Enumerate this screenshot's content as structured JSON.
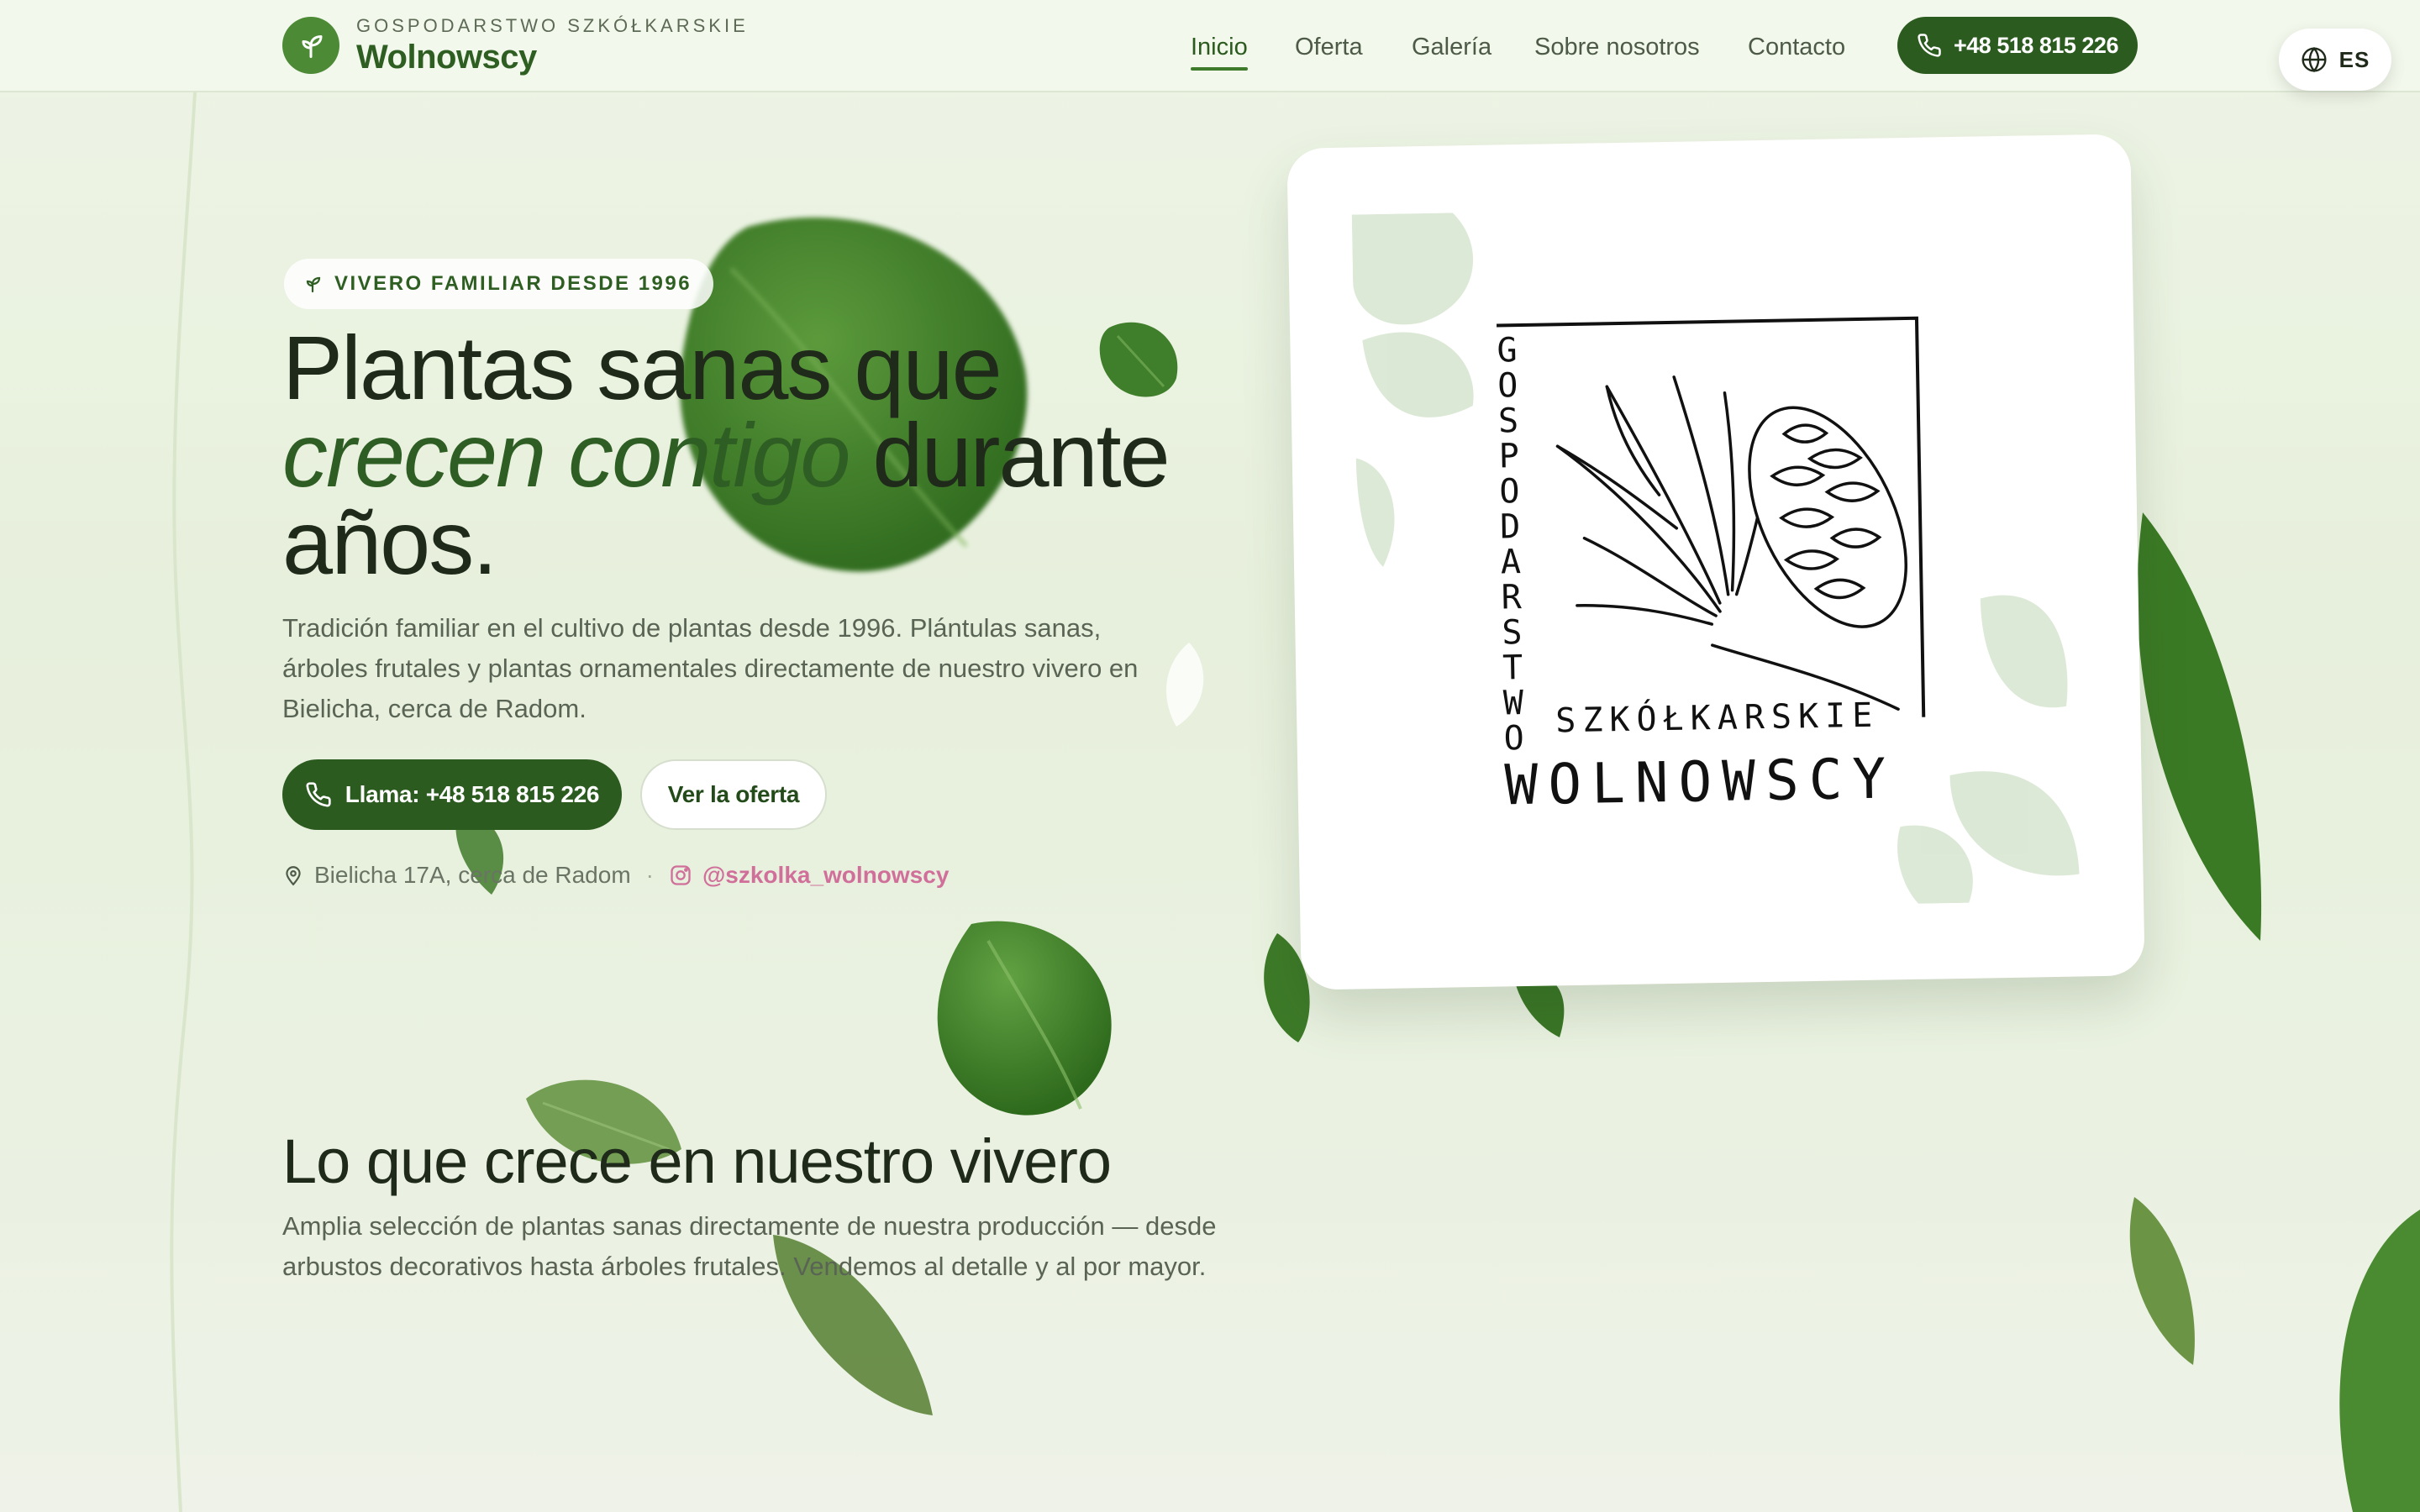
{
  "brand": {
    "eyebrow": "GOSPODARSTWO SZKÓŁKARSKIE",
    "name": "Wolnowscy"
  },
  "nav": {
    "items": [
      {
        "label": "Inicio",
        "active": true
      },
      {
        "label": "Oferta",
        "active": false
      },
      {
        "label": "Galería",
        "active": false
      },
      {
        "label": "Sobre nosotros",
        "active": false
      },
      {
        "label": "Contacto",
        "active": false
      }
    ],
    "call_label": "+48 518 815 226",
    "lang_label": "ES"
  },
  "hero": {
    "badge": "VIVERO FAMILIAR DESDE 1996",
    "title_line1": "Plantas sanas que",
    "title_accent": "crecen contigo",
    "title_rest": " durante",
    "title_line3": "años.",
    "description": "Tradición familiar en el cultivo de plantas desde 1996. Plántulas sanas, árboles frutales y plantas ornamentales directamente de nuestro vivero en Bielicha, cerca de Radom.",
    "primary_button": "Llama: +48 518 815 226",
    "secondary_button": "Ver la oferta",
    "address": "Bielicha 17A, cerca de Radom",
    "separator": "·",
    "instagram": "@szkolka_wolnowscy"
  },
  "logo_card": {
    "vertical_text": [
      "G",
      "O",
      "S",
      "P",
      "O",
      "D",
      "A",
      "R",
      "S",
      "T",
      "W",
      "O"
    ],
    "line1": "SZKÓŁKARSKIE",
    "line2": "WOLNOWSCY"
  },
  "section": {
    "title": "Lo que crece en nuestro vivero",
    "description": "Amplia selección de plantas sanas directamente de nuestra producción — desde arbustos decorativos hasta árboles frutales. Vendemos al detalle y al por mayor."
  },
  "colors": {
    "brand_green": "#2c5b20",
    "accent_green": "#4c8a36",
    "instagram_pink": "#d0709a"
  }
}
